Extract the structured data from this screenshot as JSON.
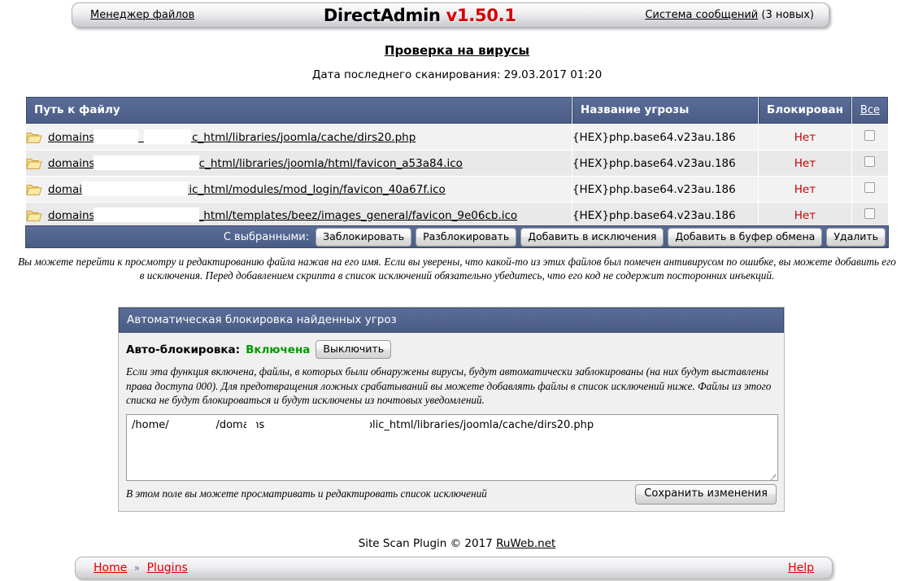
{
  "topbar": {
    "file_manager_label": "Менеджер файлов",
    "brand": "DirectAdmin",
    "version": "v1.50.1",
    "messages_link": "Система сообщений",
    "messages_count": "(3 новых)"
  },
  "page": {
    "title": "Проверка на вирусы",
    "scan_date": "Дата последнего сканирования: 29.03.2017 01:20"
  },
  "table": {
    "headers": {
      "path": "Путь к файлу",
      "threat": "Название угрозы",
      "blocked": "Блокирован",
      "select_all": "Все"
    },
    "rows": [
      {
        "icon": "folder-icon",
        "path_prefix": "domains/",
        "path_suffix": "/public_html/libraries/joomla/cache/dirs20.php",
        "threat": "{HEX}php.base64.v23au.186",
        "blocked": "Нет"
      },
      {
        "icon": "folder-icon",
        "path_prefix": "domains/",
        "path_suffix": "u/public_html/libraries/joomla/html/favicon_a53a84.ico",
        "threat": "{HEX}php.base64.v23au.186",
        "blocked": "Нет"
      },
      {
        "icon": "folder-icon",
        "path_prefix": "domains/",
        "path_suffix": "/public_html/modules/mod_login/favicon_40a67f.ico",
        "threat": "{HEX}php.base64.v23au.186",
        "blocked": "Нет"
      },
      {
        "icon": "folder-icon",
        "path_prefix": "domains/",
        "path_suffix": "/public_html/templates/beez/images_general/favicon_9e06cb.ico",
        "threat": "{HEX}php.base64.v23au.186",
        "blocked": "Нет"
      }
    ]
  },
  "action_bar": {
    "with_selected_label": "С выбранными:",
    "buttons": [
      "Заблокировать",
      "Разблокировать",
      "Добавить в исключения",
      "Добавить в буфер обмена",
      "Удалить"
    ]
  },
  "note": "Вы можете перейти к просмотру и редактированию файла нажав на его имя. Если вы уверены, что какой-то из этих файлов был помечен антивирусом по ошибке, вы можете добавить его в исключения. Перед добавлением скрипта в список исключений обязательно убедитесь, что его код не содержит посторонних инъекций.",
  "panel": {
    "header": "Автоматическая блокировка найденных угроз",
    "autoblock_label": "Авто-блокировка:",
    "autoblock_state": "Включена",
    "autoblock_state_color": "#009900",
    "toggle_button": "Выключить",
    "description": "Если эта функция включена, файлы, в которых были обнаружены вирусы, будут автоматически заблокированы (на них будут выставлены права доступа 000). Для предотвращения ложных срабатываний вы можете добавлять файлы в список исключений ниже. Файлы из этого списка не будут блокироваться и будут исключены из почтовых уведомлений.",
    "exclusions_value": "/home/              /domains/                        /public_html/libraries/joomla/cache/dirs20.php",
    "exclusions_placeholder": "",
    "footer_note": "В этом поле вы можете просматривать и редактировать список исключений",
    "save_button": "Сохранить изменения"
  },
  "credit": {
    "text": "Site Scan Plugin © 2017 ",
    "link": "RuWeb.net"
  },
  "bottombar": {
    "home": "Home",
    "separator": "»",
    "plugins": "Plugins",
    "help": "Help"
  },
  "colors": {
    "header_blue": "#4a5c86",
    "accent_red": "#d60000",
    "link_red": "#e00000",
    "ok_green": "#009900"
  }
}
